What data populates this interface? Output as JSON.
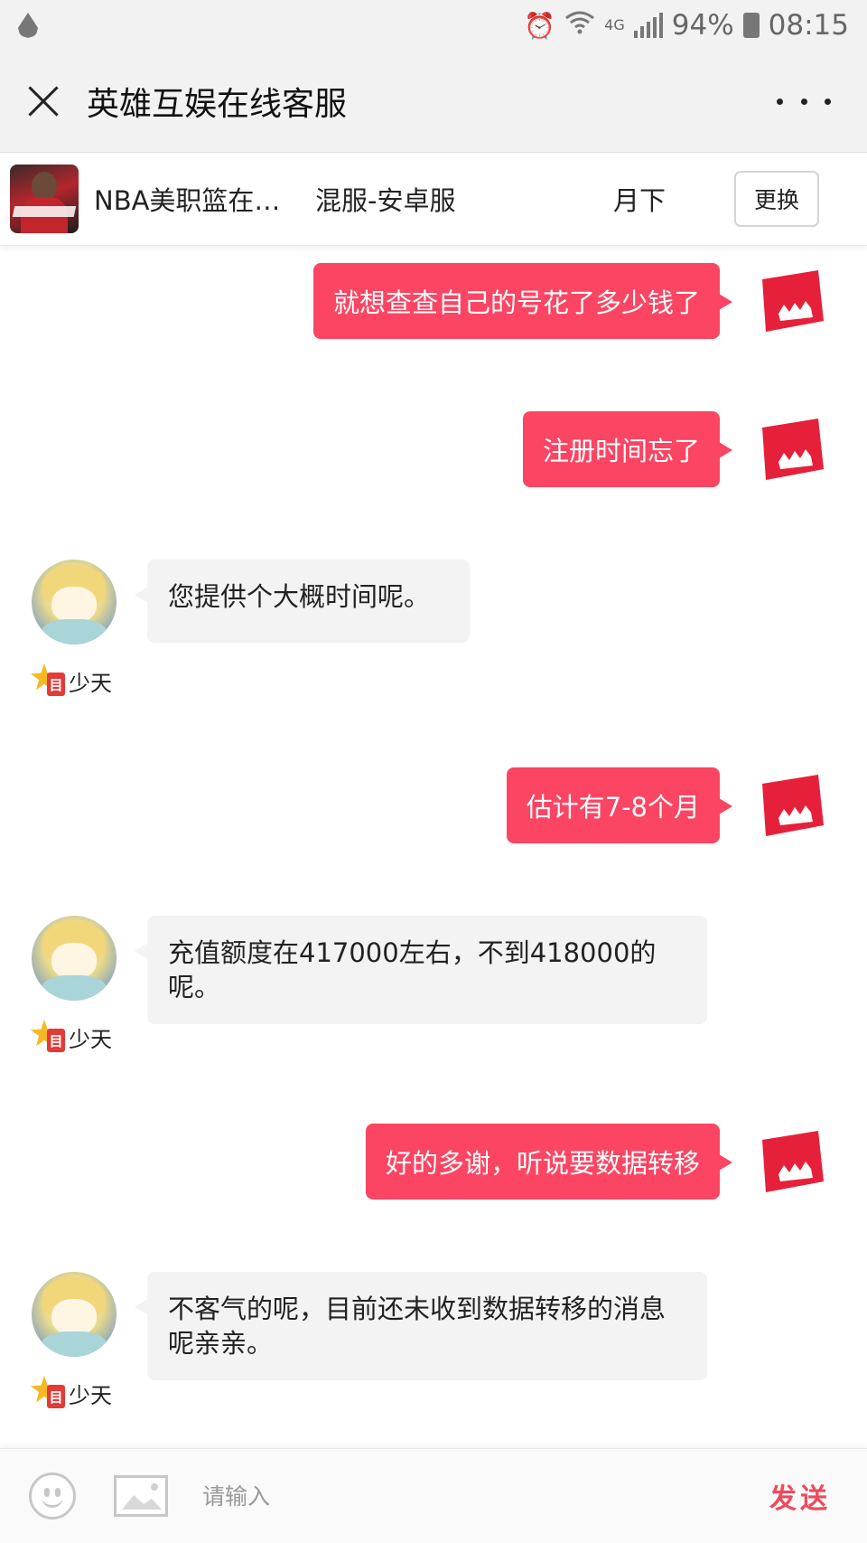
{
  "status_bar": {
    "battery": "94%",
    "time": "08:15",
    "network": "4G",
    "icons": [
      "drop-icon",
      "alarm-icon",
      "wifi-icon",
      "signal-icon",
      "battery-icon"
    ]
  },
  "header": {
    "title": "英雄互娱在线客服",
    "close_icon": "close-icon",
    "more_icon": "more-icon"
  },
  "game_info": {
    "game_name": "NBA美职篮在…",
    "server": "混服-安卓服",
    "role": "月下",
    "change_label": "更换"
  },
  "messages": [
    {
      "from": "user",
      "text": "就想查查自己的号花了多少钱了"
    },
    {
      "from": "user",
      "text": "注册时间忘了"
    },
    {
      "from": "agent",
      "text": "您提供个大概时间呢。",
      "agent_name": "少天"
    },
    {
      "from": "user",
      "text": "估计有7-8个月"
    },
    {
      "from": "agent",
      "text": "充值额度在417000左右，不到418000的呢。",
      "agent_name": "少天"
    },
    {
      "from": "user",
      "text": "好的多谢，听说要数据转移"
    },
    {
      "from": "agent",
      "text": "不客气的呢，目前还未收到数据转移的消息呢亲亲。",
      "agent_name": "少天"
    }
  ],
  "input_bar": {
    "placeholder": "请输入",
    "value": "",
    "send_label": "发送"
  },
  "colors": {
    "user_bubble": "#fb4563",
    "agent_bubble": "#f3f3f3",
    "send_text": "#ef4a5c",
    "status_bar_bg": "#f2f2f2"
  }
}
